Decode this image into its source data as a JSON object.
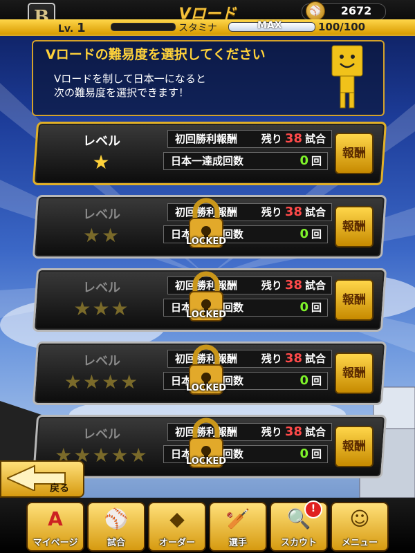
{
  "header": {
    "logo_text": "B",
    "title": "Vロード",
    "coin_icon": "coin-icon",
    "coin_count": "2672",
    "level_prefix": "Lv.",
    "level": "1",
    "stamina_label": "スタミナ",
    "stamina_max": "MAX",
    "stamina_value": "100/100"
  },
  "info": {
    "title": "Vロードの難易度を選択してください",
    "text": "Vロードを制して日本一になると\n次の難易度を選択できます！",
    "mascot_icon": "mascot-icon"
  },
  "levels": [
    {
      "label": "レベル",
      "stars": "★",
      "reward_title": "初回勝利報酬",
      "remaining_label": "残り",
      "remaining": "38",
      "remaining_unit": "試合",
      "achieve_label": "日本一達成回数",
      "achieve_count": "0",
      "achieve_unit": "回",
      "reward_button": "報酬",
      "locked": false
    },
    {
      "label": "レベル",
      "stars": "★★",
      "reward_title": "初回勝利報酬",
      "remaining_label": "残り",
      "remaining": "38",
      "remaining_unit": "試合",
      "achieve_label": "日本一達成回数",
      "achieve_count": "0",
      "achieve_unit": "回",
      "reward_button": "報酬",
      "locked": true,
      "locked_text": "LOCKED"
    },
    {
      "label": "レベル",
      "stars": "★★★",
      "reward_title": "初回勝利報酬",
      "remaining_label": "残り",
      "remaining": "38",
      "remaining_unit": "試合",
      "achieve_label": "日本一達成回数",
      "achieve_count": "0",
      "achieve_unit": "回",
      "reward_button": "報酬",
      "locked": true,
      "locked_text": "LOCKED"
    },
    {
      "label": "レベル",
      "stars": "★★★★",
      "reward_title": "初回勝利報酬",
      "remaining_label": "残り",
      "remaining": "38",
      "remaining_unit": "試合",
      "achieve_label": "日本一達成回数",
      "achieve_count": "0",
      "achieve_unit": "回",
      "reward_button": "報酬",
      "locked": true,
      "locked_text": "LOCKED"
    },
    {
      "label": "レベル",
      "stars": "★★★★★",
      "reward_title": "初回勝利報酬",
      "remaining_label": "残り",
      "remaining": "38",
      "remaining_unit": "試合",
      "achieve_label": "日本一達成回数",
      "achieve_count": "0",
      "achieve_unit": "回",
      "reward_button": "報酬",
      "locked": true,
      "locked_text": "LOCKED"
    }
  ],
  "back_button": {
    "label": "戻る",
    "icon": "back-arrow-icon"
  },
  "nav": [
    {
      "label": "マイページ",
      "icon": "A"
    },
    {
      "label": "試合",
      "icon": "field-icon"
    },
    {
      "label": "オーダー",
      "icon": "diamond-icon"
    },
    {
      "label": "選手",
      "icon": "player-icon"
    },
    {
      "label": "スカウト",
      "icon": "scout-icon"
    },
    {
      "label": "メニュー",
      "icon": "menu-mascot-icon"
    }
  ],
  "scout_badge": "!"
}
